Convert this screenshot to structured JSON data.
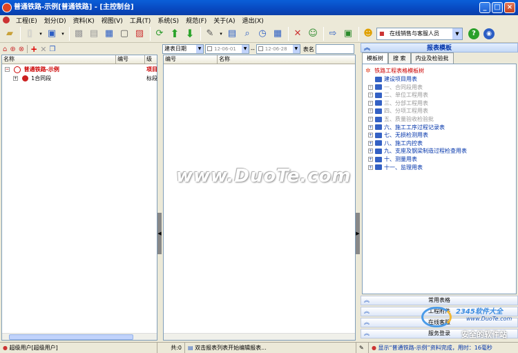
{
  "window": {
    "title": "普通铁路-示例[普通铁路] - [主控制台]",
    "min": "_",
    "max": "□",
    "close": "×"
  },
  "menu": {
    "items": [
      "工程(E)",
      "划分(D)",
      "资料(K)",
      "视图(V)",
      "工具(T)",
      "系统(S)",
      "规范(F)",
      "关于(A)",
      "退出(X)"
    ]
  },
  "toolbar": {
    "user_combo": "在线销售与客服人员"
  },
  "left_panel": {
    "columns": [
      "名称",
      "编号",
      "级别"
    ],
    "rows": [
      {
        "label": "普通铁路-示例",
        "level": "项目"
      },
      {
        "label": "1合同段",
        "level": "标段"
      }
    ]
  },
  "middle_panel": {
    "filter_field": "建表日期",
    "date_from": "12-06-01",
    "range_sep": "--",
    "date_to": "12-06-28",
    "name_label": "表名",
    "columns": [
      "编号",
      "名称"
    ]
  },
  "right_panel": {
    "header": "报表模板",
    "tabs": [
      "模板树",
      "搜 索",
      "内业及检验批"
    ],
    "tree_root": "铁路工程表格模板树",
    "tree_items": [
      {
        "label": "建设项目用表",
        "enabled": true,
        "expand": false
      },
      {
        "label": "一、合同段用表",
        "enabled": false,
        "expand": true
      },
      {
        "label": "二、单位工程用表",
        "enabled": false,
        "expand": true
      },
      {
        "label": "三、分部工程用表",
        "enabled": false,
        "expand": true
      },
      {
        "label": "四、分项工程用表",
        "enabled": false,
        "expand": true
      },
      {
        "label": "五、质量验收检验批",
        "enabled": false,
        "expand": true
      },
      {
        "label": "六、施工工序过程记录表",
        "enabled": true,
        "expand": true
      },
      {
        "label": "七、无损检测用表",
        "enabled": true,
        "expand": true
      },
      {
        "label": "八、施工内控表",
        "enabled": true,
        "expand": true
      },
      {
        "label": "九、支座及钢梁制造过程检查用表",
        "enabled": true,
        "expand": true
      },
      {
        "label": "十、测量用表",
        "enabled": true,
        "expand": true
      },
      {
        "label": "十一、监理用表",
        "enabled": true,
        "expand": true
      }
    ],
    "accordion": [
      "常用表格",
      "工程附件",
      "在线客服",
      "服务登录"
    ]
  },
  "statusbar": {
    "user": "超级用户[超级用户]",
    "count": "共:0",
    "hint": "双击报表列表开始编辑报表...",
    "message": "显示“普通铁路-示例”资料完成，用时：16毫秒"
  },
  "watermark": "www.DuoTe.com",
  "corner_logo": {
    "brand": "2345软件大全",
    "url": "www.DuoTe.com",
    "slogan": "安全的软件站"
  },
  "colors": {
    "title_blue": "#0a5fd8",
    "project_red": "#cc0000",
    "tree_blue": "#0033aa",
    "disabled_gray": "#9a9a9a"
  }
}
